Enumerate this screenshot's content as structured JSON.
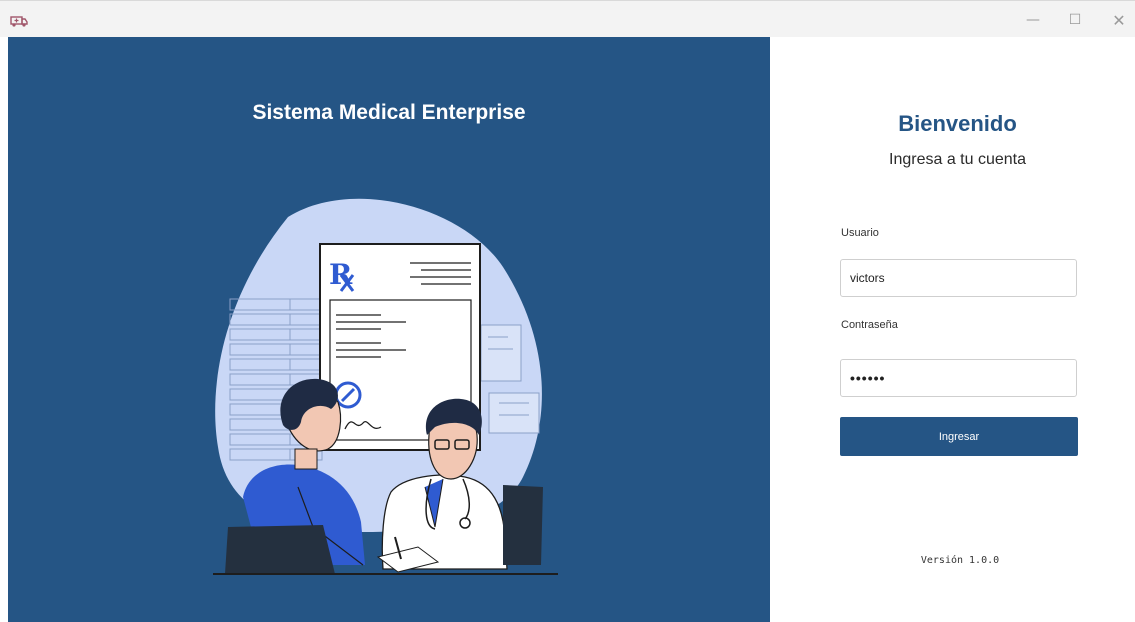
{
  "window": {
    "icons": {
      "app": "ambulance-icon",
      "minimize": "minimize-icon",
      "maximize": "maximize-icon",
      "close": "close-icon"
    },
    "minimize_glyph": "—",
    "maximize_glyph": "☐",
    "close_glyph": "✕"
  },
  "left_panel": {
    "title": "Sistema Medical Enterprise",
    "background_color": "#255585",
    "illustration": "doctor-consultation-illustration",
    "prescription_symbol": "R"
  },
  "login": {
    "heading": "Bienvenido",
    "subtitle": "Ingresa a tu cuenta",
    "username_label": "Usuario",
    "username_value": "victors",
    "password_label": "Contraseña",
    "password_mask": "••••••",
    "submit_label": "Ingresar",
    "accent_color": "#255585"
  },
  "footer": {
    "version": "Versión 1.0.0"
  }
}
